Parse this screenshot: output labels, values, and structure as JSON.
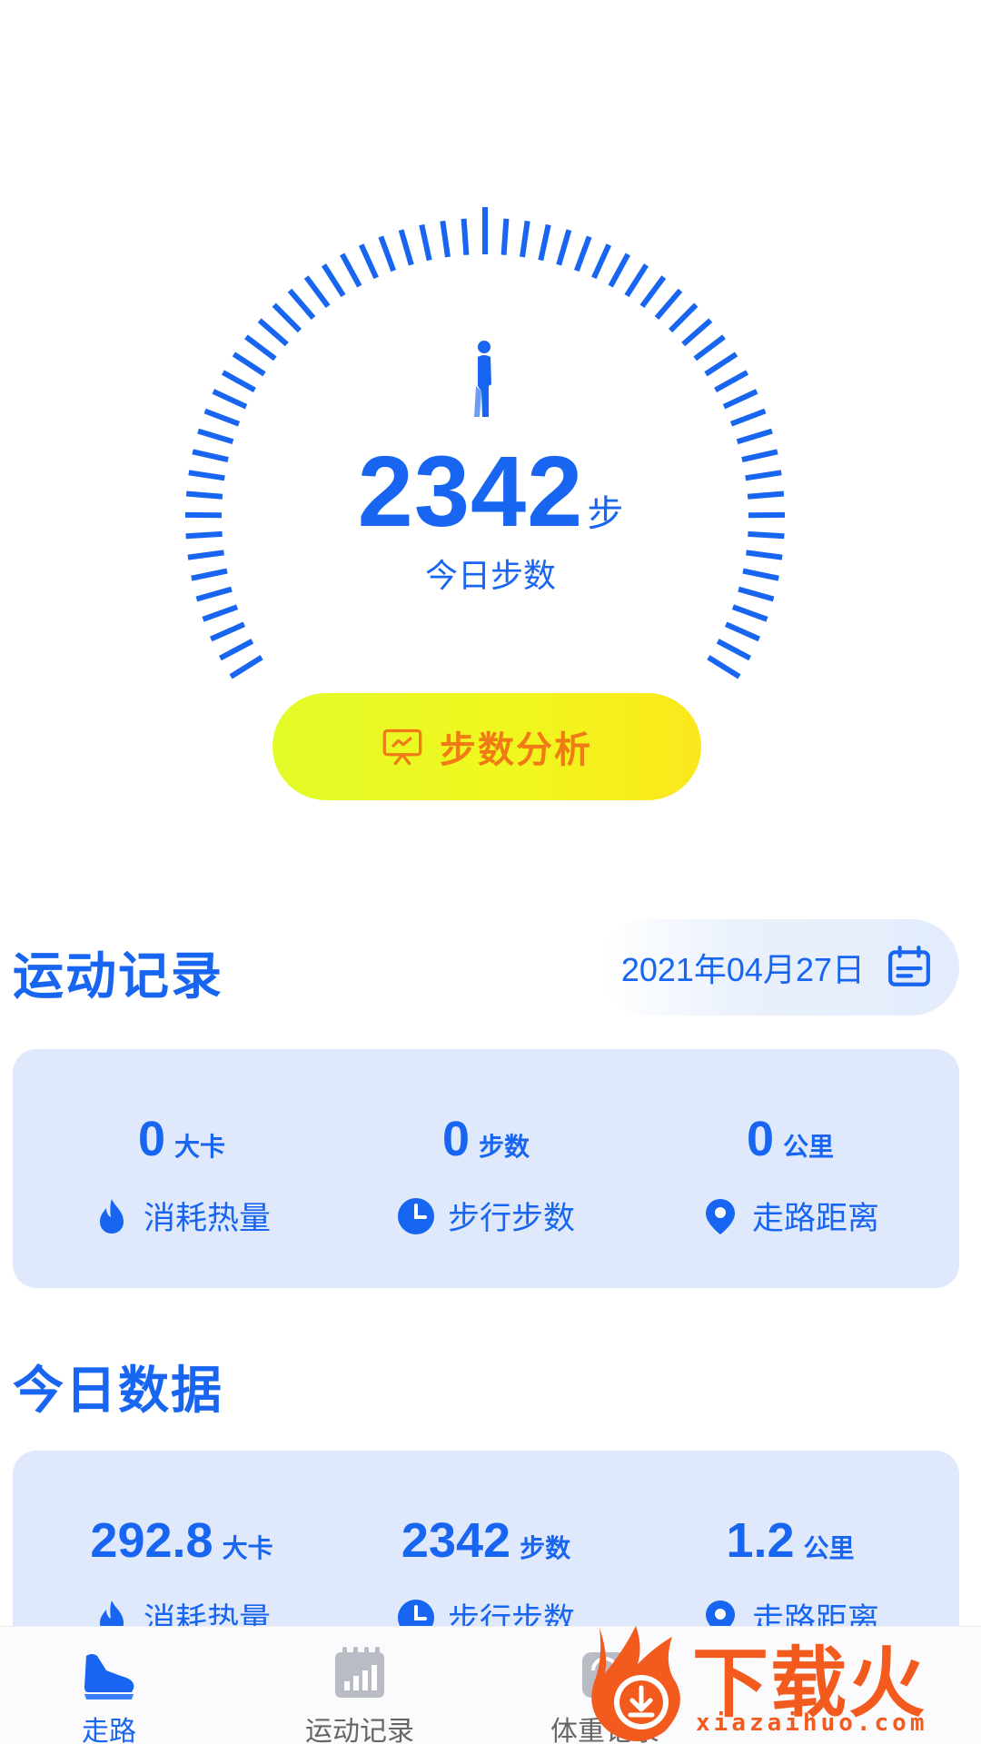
{
  "gauge": {
    "steps": "2342",
    "steps_unit": "步",
    "label": "今日步数",
    "button_label": "步数分析",
    "accent": "#1765f0",
    "icon": "walking-person-icon"
  },
  "record_section": {
    "title": "运动记录",
    "date": "2021年04月27日",
    "date_icon": "calendar-icon",
    "stats": [
      {
        "value": "0",
        "unit": "大卡",
        "label": "消耗热量",
        "icon": "flame-icon"
      },
      {
        "value": "0",
        "unit": "步数",
        "label": "步行步数",
        "icon": "clock-icon"
      },
      {
        "value": "0",
        "unit": "公里",
        "label": "走路距离",
        "icon": "location-pin-icon"
      }
    ]
  },
  "today_section": {
    "title": "今日数据",
    "stats": [
      {
        "value": "292.8",
        "unit": "大卡",
        "label": "消耗热量",
        "icon": "flame-icon"
      },
      {
        "value": "2342",
        "unit": "步数",
        "label": "步行步数",
        "icon": "clock-icon"
      },
      {
        "value": "1.2",
        "unit": "公里",
        "label": "走路距离",
        "icon": "location-pin-icon"
      }
    ]
  },
  "nav": {
    "items": [
      {
        "label": "走路",
        "icon": "shoe-icon",
        "active": true
      },
      {
        "label": "运动记录",
        "icon": "bar-chart-calendar-icon",
        "active": false
      },
      {
        "label": "体重记录",
        "icon": "scale-icon",
        "active": false
      }
    ]
  },
  "watermark": {
    "brand": "下载火",
    "url": "xiazaihuo.com",
    "color": "#f25a1e"
  }
}
